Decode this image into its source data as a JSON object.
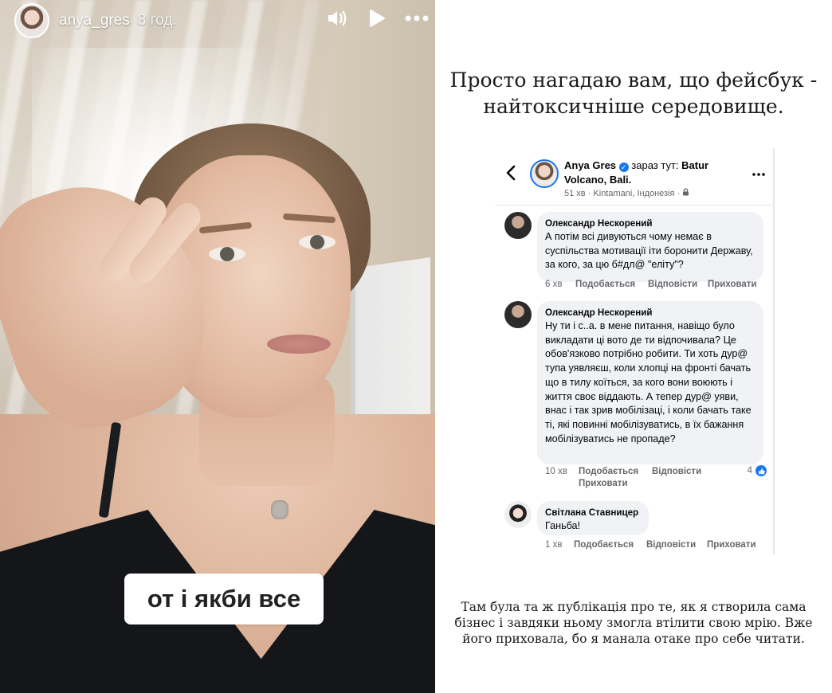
{
  "story": {
    "username": "anya_gres",
    "time": "8 год.",
    "caption": "от і якби все",
    "icons": [
      "sound-icon",
      "play-icon",
      "more-icon"
    ]
  },
  "right": {
    "heading": "Просто нагадаю вам, що фейсбук - найтоксичніше середовище.",
    "footer": "Там була та ж публікація про те, як я створила сама бізнес і завдяки ньому змогла втілити свою мрію. Вже його приховала, бо я манала отаке про себе читати."
  },
  "fb_post": {
    "author": "Anya Gres",
    "location_prefix": "зараз тут:",
    "location": "Batur Volcano, Bali.",
    "meta": "51 хв · Kintamani, Індонезія ·",
    "comments": [
      {
        "name": "Олександр Нескорений",
        "text": "А потім всі дивуються чому немає в суспільства мотивації іти боронити Державу, за кого, за цю б#дл@ \"еліту\"?",
        "time": "6 хв",
        "like": "Подобається",
        "reply": "Відповісти",
        "hide": "Приховати"
      },
      {
        "name": "Олександр Нескорений",
        "text": "Ну ти і с..а. в мене питання, навіщо було викладати ці вото де ти відпочивала? Це обов'язково потрібно робити. Ти хоть дур@ тупа уявляєш, коли хлопці на фронті бачать що в тилу коїться, за кого вони воюють і життя своє віддають. А тепер дур@ уяви, внас і так зрив мобілізаці, і коли бачать таке ті, які повинні мобілізуватись, в їх бажання мобілізуватись не пропаде?",
        "time": "10 хв",
        "like": "Подобається",
        "reply": "Відповісти",
        "hide": "Приховати",
        "likes": "4"
      },
      {
        "name": "Світлана Ставницер",
        "text": "Ганьба!",
        "time": "1 хв",
        "like": "Подобається",
        "reply": "Відповісти",
        "hide": "Приховати"
      }
    ]
  },
  "colors": {
    "fb_blue": "#1877f2",
    "bubble_bg": "#f0f2f5",
    "meta_gray": "#65676b",
    "story_top": "#15161a"
  }
}
